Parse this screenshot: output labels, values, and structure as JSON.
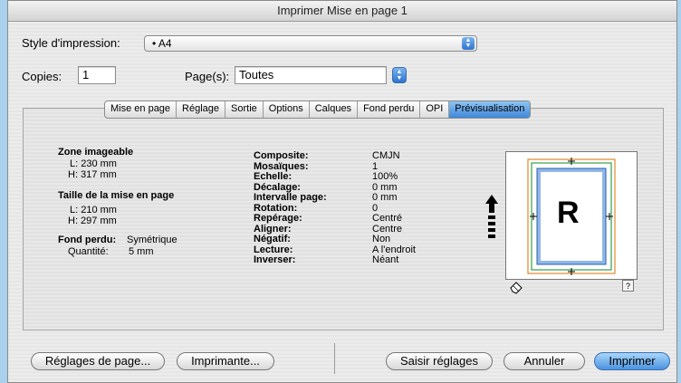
{
  "window": {
    "title": "Imprimer Mise en page 1"
  },
  "style": {
    "label": "Style d'impression:",
    "value": "• A4"
  },
  "copies": {
    "label": "Copies:",
    "value": "1"
  },
  "pages": {
    "label": "Page(s):",
    "value": "Toutes"
  },
  "tabs": [
    "Mise en page",
    "Réglage",
    "Sortie",
    "Options",
    "Calques",
    "Fond perdu",
    "OPI",
    "Prévisualisation"
  ],
  "active_tab": "Prévisualisation",
  "left_info": {
    "zone_title": "Zone imageable",
    "zone_l": "L: 230 mm",
    "zone_h": "H: 317 mm",
    "taille_title": "Taille de la mise en page",
    "taille_l": "L: 210 mm",
    "taille_h": "H: 297 mm",
    "fond_label": "Fond perdu:",
    "fond_value": "Symétrique",
    "quantite_label": "Quantité:",
    "quantite_value": "5 mm"
  },
  "settings": [
    {
      "label": "Composite:",
      "value": "CMJN"
    },
    {
      "label": "Mosaïques:",
      "value": "1"
    },
    {
      "label": "Echelle:",
      "value": "100%"
    },
    {
      "label": "Décalage:",
      "value": "0 mm"
    },
    {
      "label": "Intervalle page:",
      "value": "0 mm"
    },
    {
      "label": "Rotation:",
      "value": "0"
    },
    {
      "label": "Repérage:",
      "value": "Centré"
    },
    {
      "label": "Aligner:",
      "value": "Centre"
    },
    {
      "label": "Négatif:",
      "value": "Non"
    },
    {
      "label": "Lecture:",
      "value": "A l'endroit"
    },
    {
      "label": "Inverser:",
      "value": "Néant"
    }
  ],
  "preview": {
    "letter": "R",
    "help": "?"
  },
  "buttons": {
    "page_setup": "Réglages de page...",
    "printer": "Imprimante...",
    "capture": "Saisir réglages",
    "cancel": "Annuler",
    "print": "Imprimer"
  },
  "colors": {
    "accent": "#3f87d9",
    "background": "#a9d1ee"
  }
}
